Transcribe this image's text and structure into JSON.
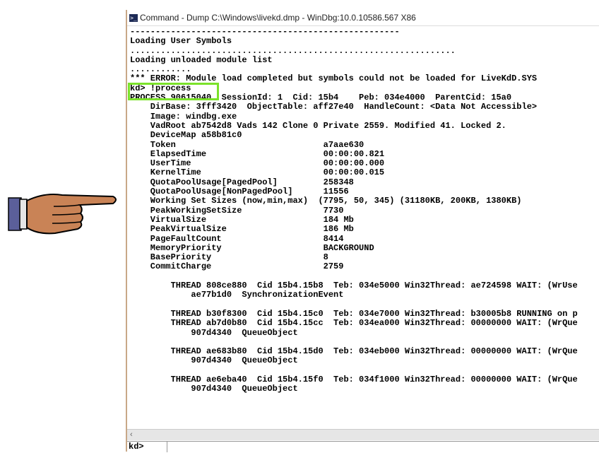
{
  "window": {
    "title": "Command - Dump C:\\Windows\\livekd.dmp - WinDbg:10.0.10586.567 X86",
    "icon": "console-icon"
  },
  "output_lines": [
    "-----------------------------------------------------",
    "Loading User Symbols",
    "................................................................",
    "Loading unloaded module list",
    "............",
    "*** ERROR: Module load completed but symbols could not be loaded for LiveKdD.SYS",
    "kd> !process",
    "PROCESS 90615040  SessionId: 1  Cid: 15b4    Peb: 034e4000  ParentCid: 15a0",
    "    DirBase: 3fff3420  ObjectTable: aff27e40  HandleCount: <Data Not Accessible>",
    "    Image: windbg.exe",
    "    VadRoot ab7542d8 Vads 142 Clone 0 Private 2559. Modified 41. Locked 2.",
    "    DeviceMap a58b81c0",
    "    Token                             a7aae630",
    "    ElapsedTime                       00:00:00.821",
    "    UserTime                          00:00:00.000",
    "    KernelTime                        00:00:00.015",
    "    QuotaPoolUsage[PagedPool]         258348",
    "    QuotaPoolUsage[NonPagedPool]      11556",
    "    Working Set Sizes (now,min,max)  (7795, 50, 345) (31180KB, 200KB, 1380KB)",
    "    PeakWorkingSetSize                7730",
    "    VirtualSize                       184 Mb",
    "    PeakVirtualSize                   186 Mb",
    "    PageFaultCount                    8414",
    "    MemoryPriority                    BACKGROUND",
    "    BasePriority                      8",
    "    CommitCharge                      2759",
    "",
    "        THREAD 808ce880  Cid 15b4.15b8  Teb: 034e5000 Win32Thread: ae724598 WAIT: (WrUse",
    "            ae77b1d0  SynchronizationEvent",
    "",
    "        THREAD b30f8300  Cid 15b4.15c0  Teb: 034e7000 Win32Thread: b30005b8 RUNNING on p",
    "        THREAD ab7d0b80  Cid 15b4.15cc  Teb: 034ea000 Win32Thread: 00000000 WAIT: (WrQue",
    "            907d4340  QueueObject",
    "",
    "        THREAD ae683b80  Cid 15b4.15d0  Teb: 034eb000 Win32Thread: 00000000 WAIT: (WrQue",
    "            907d4340  QueueObject",
    "",
    "        THREAD ae6eba40  Cid 15b4.15f0  Teb: 034f1000 Win32Thread: 00000000 WAIT: (WrQue",
    "            907d4340  QueueObject"
  ],
  "command_bar": {
    "prompt": "kd>",
    "value": ""
  },
  "scrollbar": {
    "left_arrow": "‹"
  },
  "colors": {
    "highlight": "#7be22a"
  }
}
